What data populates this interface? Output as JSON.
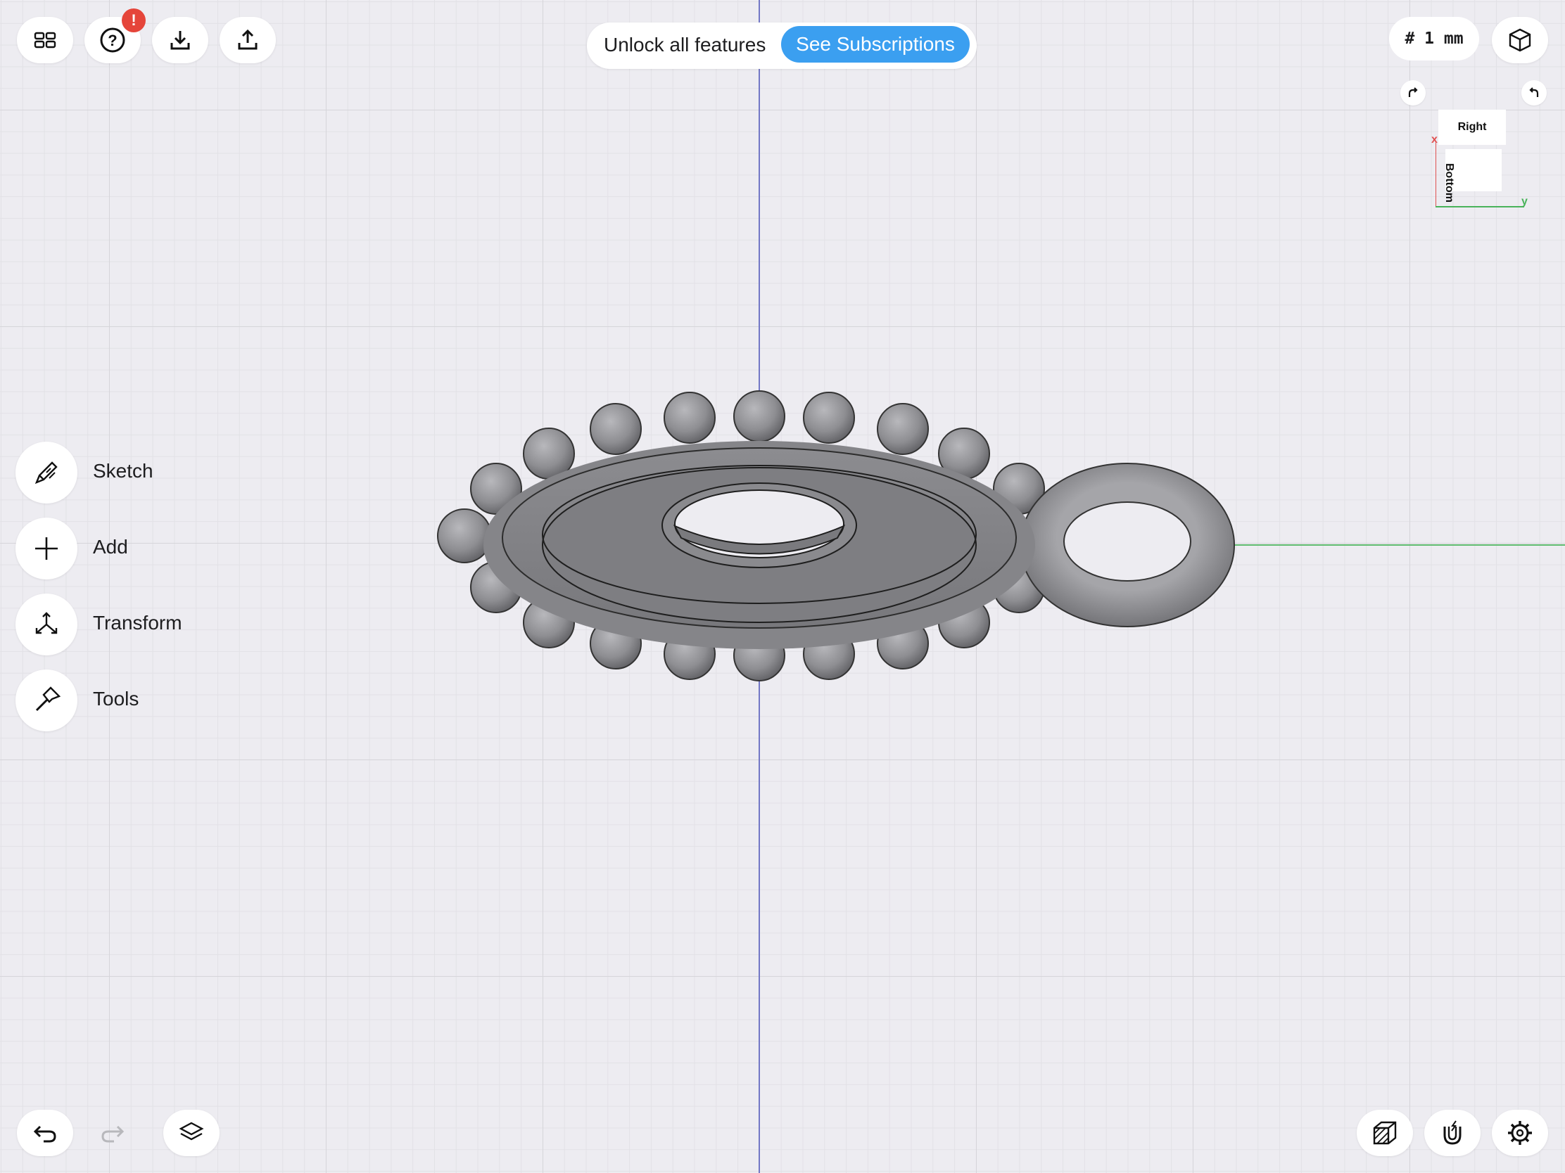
{
  "top_left_toolbar": [
    {
      "name": "grid-view-icon"
    },
    {
      "name": "help-icon",
      "badge": "!"
    },
    {
      "name": "download-icon"
    },
    {
      "name": "upload-icon"
    }
  ],
  "banner": {
    "message": "Unlock all features",
    "button_label": "See Subscriptions"
  },
  "grid_size": "# 1 mm",
  "view_cube": {
    "faces": {
      "right": "Right",
      "bottom": "Bottom"
    },
    "axes": {
      "x": "x",
      "y": "y"
    }
  },
  "side_menu": {
    "items": [
      {
        "label": "Sketch",
        "icon": "pencil-icon"
      },
      {
        "label": "Add",
        "icon": "plus-icon"
      },
      {
        "label": "Transform",
        "icon": "transform-arrows-icon"
      },
      {
        "label": "Tools",
        "icon": "hammer-icon"
      }
    ]
  },
  "bottom_left_toolbar": [
    "undo-icon",
    "redo-icon",
    "layers-icon"
  ],
  "bottom_right_toolbar": [
    "display-mode-icon",
    "snap-magnet-icon",
    "settings-gear-icon"
  ],
  "colors": {
    "accent": "#3b9ff0",
    "badge": "#e5453a",
    "background": "#edecf1",
    "x_axis": "#e05050",
    "y_axis": "#49b35a",
    "z_axis": "#5a60c8"
  }
}
